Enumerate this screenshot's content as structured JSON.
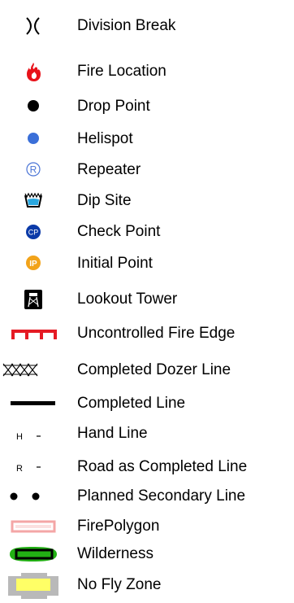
{
  "legend": {
    "items": [
      {
        "label": "Division Break",
        "icon": "division-break-icon"
      },
      {
        "label": "Fire Location",
        "icon": "fire-icon"
      },
      {
        "label": "Drop Point",
        "icon": "drop-point-icon"
      },
      {
        "label": "Helispot",
        "icon": "helispot-icon"
      },
      {
        "label": "Repeater",
        "icon": "repeater-icon",
        "glyph": "R"
      },
      {
        "label": "Dip Site",
        "icon": "dip-site-icon"
      },
      {
        "label": "Check Point",
        "icon": "check-point-icon",
        "glyph": "CP"
      },
      {
        "label": "Initial Point",
        "icon": "initial-point-icon",
        "glyph": "IP"
      },
      {
        "label": "Lookout Tower",
        "icon": "lookout-tower-icon"
      },
      {
        "label": "Uncontrolled Fire Edge",
        "icon": "uncontrolled-fire-edge-icon"
      },
      {
        "label": "Completed Dozer Line",
        "icon": "completed-dozer-line-icon"
      },
      {
        "label": "Completed Line",
        "icon": "completed-line-icon"
      },
      {
        "label": "Hand Line",
        "icon": "hand-line-icon",
        "glyph": "H"
      },
      {
        "label": "Road as Completed Line",
        "icon": "road-completed-line-icon",
        "glyph": "R"
      },
      {
        "label": "Planned Secondary Line",
        "icon": "planned-secondary-line-icon"
      },
      {
        "label": "FirePolygon",
        "icon": "fire-polygon-icon"
      },
      {
        "label": "Wilderness",
        "icon": "wilderness-icon"
      },
      {
        "label": "No Fly Zone",
        "icon": "no-fly-zone-icon"
      }
    ]
  },
  "colors": {
    "text": "#000000",
    "fire_red": "#e8121a",
    "helispot_blue": "#3a6fd8",
    "repeater_blue": "#4a74d6",
    "dip_site_blue": "#2aa8e0",
    "check_point_blue": "#0b3aa8",
    "initial_point_orange": "#f2a31a",
    "uncontrolled_edge_red": "#e51b24",
    "fire_polygon_pink": "#f4a6a6",
    "wilderness_green": "#22b014",
    "no_fly_gray": "#b9b9b9",
    "no_fly_yellow": "#ffff66"
  }
}
